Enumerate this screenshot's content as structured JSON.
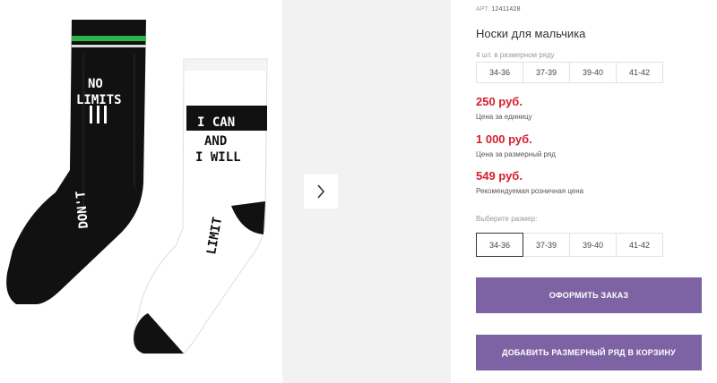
{
  "product": {
    "article_label": "АРТ.",
    "article_number": "12411428",
    "title": "Носки для мальчика",
    "pack_note": "4 шт. в размерном ряду",
    "pack_sizes": [
      "34-36",
      "37-39",
      "39-40",
      "41-42"
    ]
  },
  "gallery": {
    "sock_left_text": [
      "NO",
      "LIMITS",
      "DON'T"
    ],
    "sock_right_text": [
      "I CAN",
      "AND",
      "I WILL",
      "LIMIT"
    ],
    "next_icon": "chevron-right-icon"
  },
  "prices": [
    {
      "value": "250 руб.",
      "note": "Цена за единицу"
    },
    {
      "value": "1 000 руб.",
      "note": "Цена за размерный ряд"
    },
    {
      "value": "549 руб.",
      "note": "Рекомендуемая розничная цена"
    }
  ],
  "size_select": {
    "label": "Выберите размер:",
    "options": [
      "34-36",
      "37-39",
      "39-40",
      "41-42"
    ],
    "selected": "34-36"
  },
  "actions": {
    "order_label": "ОФОРМИТЬ ЗАКАЗ",
    "add_set_label": "ДОБАВИТЬ РАЗМЕРНЫЙ РЯД В КОРЗИНУ"
  },
  "colors": {
    "price": "#d4202e",
    "button": "#7e63a4",
    "accent_green": "#2db34a"
  }
}
